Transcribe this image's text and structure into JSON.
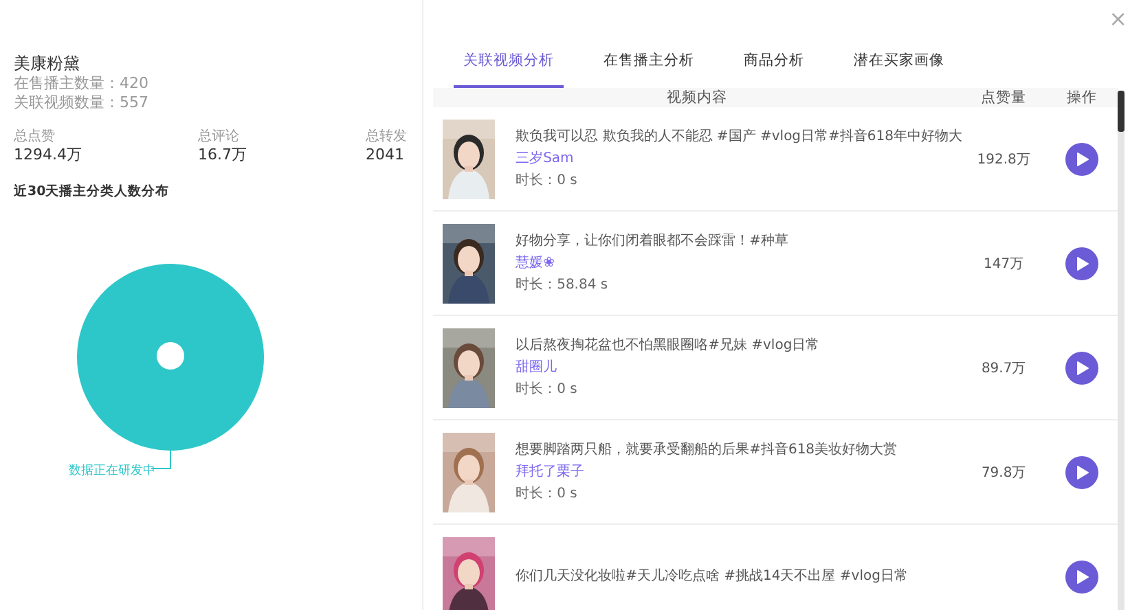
{
  "close": "×",
  "brand": {
    "name": "美康粉黛",
    "lines": [
      "在售播主数量：420",
      "关联视频数量：557"
    ],
    "stats": [
      {
        "label": "总点赞",
        "value": "1294.4万"
      },
      {
        "label": "总评论",
        "value": "16.7万"
      },
      {
        "label": "总转发",
        "value": "2041"
      }
    ],
    "section_title": "近30天播主分类人数分布",
    "chart_note": "数据正在研发中"
  },
  "tabs": [
    {
      "label": "关联视频分析",
      "selected": true
    },
    {
      "label": "在售播主分析",
      "selected": false
    },
    {
      "label": "商品分析",
      "selected": false
    },
    {
      "label": "潜在买家画像",
      "selected": false
    }
  ],
  "table": {
    "columns": [
      "视频内容",
      "点赞量",
      "操作"
    ],
    "rows": [
      {
        "title": "欺负我可以忍 欺负我的人不能忍 #国产 #vlog日常#抖音618年中好物大",
        "author": "三岁Sam",
        "duration": "时长：0 s",
        "likes": "192.8万"
      },
      {
        "title": "好物分享，让你们闭着眼都不会踩雷！#种草",
        "author": "慧媛❀",
        "duration": "时长：58.84 s",
        "likes": "147万"
      },
      {
        "title": "以后熬夜掏花盆也不怕黑眼圈咯#兄妹 #vlog日常",
        "author": "甜圈儿",
        "duration": "时长：0 s",
        "likes": "89.7万"
      },
      {
        "title": "想要脚踏两只船，就要承受翻船的后果#抖音618美妆好物大赏",
        "author": "拜托了栗子",
        "duration": "时长：0 s",
        "likes": "79.8万"
      },
      {
        "title": "你们几天没化妆啦#天儿冷吃点啥 #挑战14天不出屋 #vlog日常"
      }
    ]
  }
}
